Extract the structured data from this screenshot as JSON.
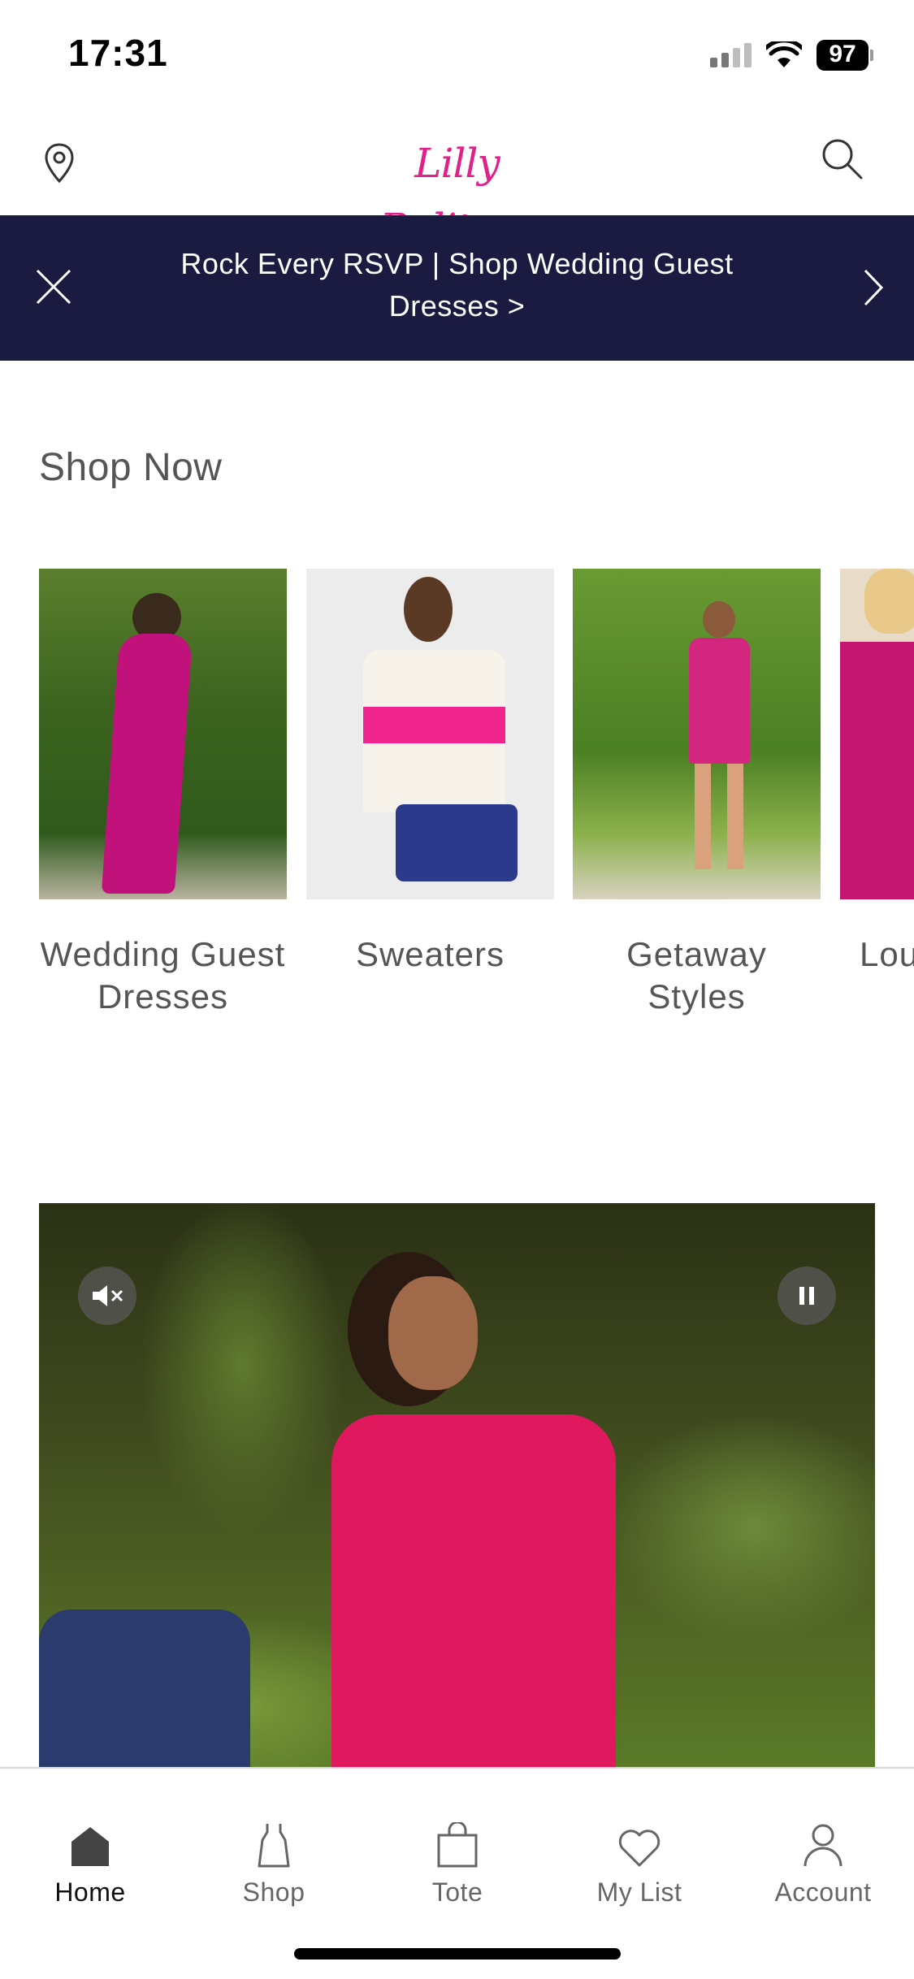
{
  "status_bar": {
    "time": "17:31",
    "battery": "97"
  },
  "header": {
    "logo_text": "Lilly Pulitzer",
    "location_icon": "map-pin-icon",
    "search_icon": "search-icon"
  },
  "promo": {
    "text": "Rock Every RSVP | Shop Wedding Guest Dresses >",
    "background": "#1b1b42"
  },
  "shop_now": {
    "title": "Shop Now",
    "items": [
      {
        "label": "Wedding Guest Dresses"
      },
      {
        "label": "Sweaters"
      },
      {
        "label": "Getaway Styles"
      },
      {
        "label": "Lou"
      }
    ]
  },
  "video": {
    "mute_icon": "speaker-muted-icon",
    "pause_icon": "pause-icon"
  },
  "tabbar": {
    "items": [
      {
        "label": "Home",
        "icon": "home-icon",
        "active": true
      },
      {
        "label": "Shop",
        "icon": "dress-icon"
      },
      {
        "label": "Tote",
        "icon": "shopping-bag-icon"
      },
      {
        "label": "My List",
        "icon": "heart-icon"
      },
      {
        "label": "Account",
        "icon": "user-icon"
      }
    ]
  },
  "colors": {
    "brand_pink": "#e0218a",
    "navy": "#1b1b42"
  }
}
